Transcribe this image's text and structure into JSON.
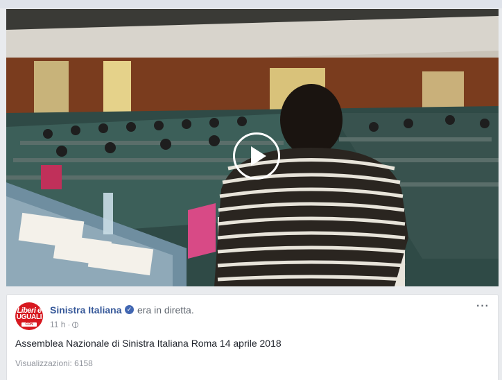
{
  "post": {
    "author": "Sinistra Italiana",
    "action": "era in diretta.",
    "time": "11 h",
    "separator": "·",
    "text": "Assemblea Nazionale di Sinistra Italiana Roma 14 aprile 2018",
    "views": "Visualizzazioni: 6158",
    "more": "···",
    "avatar": {
      "line1": "Liberi e",
      "line2": "UGUALI",
      "line3": "CON PIETRO GRASSO"
    }
  },
  "icons": {
    "verified": "verified-badge-icon",
    "privacy": "globe-icon",
    "play": "play-icon"
  },
  "colors": {
    "link": "#365899",
    "muted": "#90949c",
    "avatar_red": "#d71920",
    "verified_blue": "#4267b2"
  }
}
